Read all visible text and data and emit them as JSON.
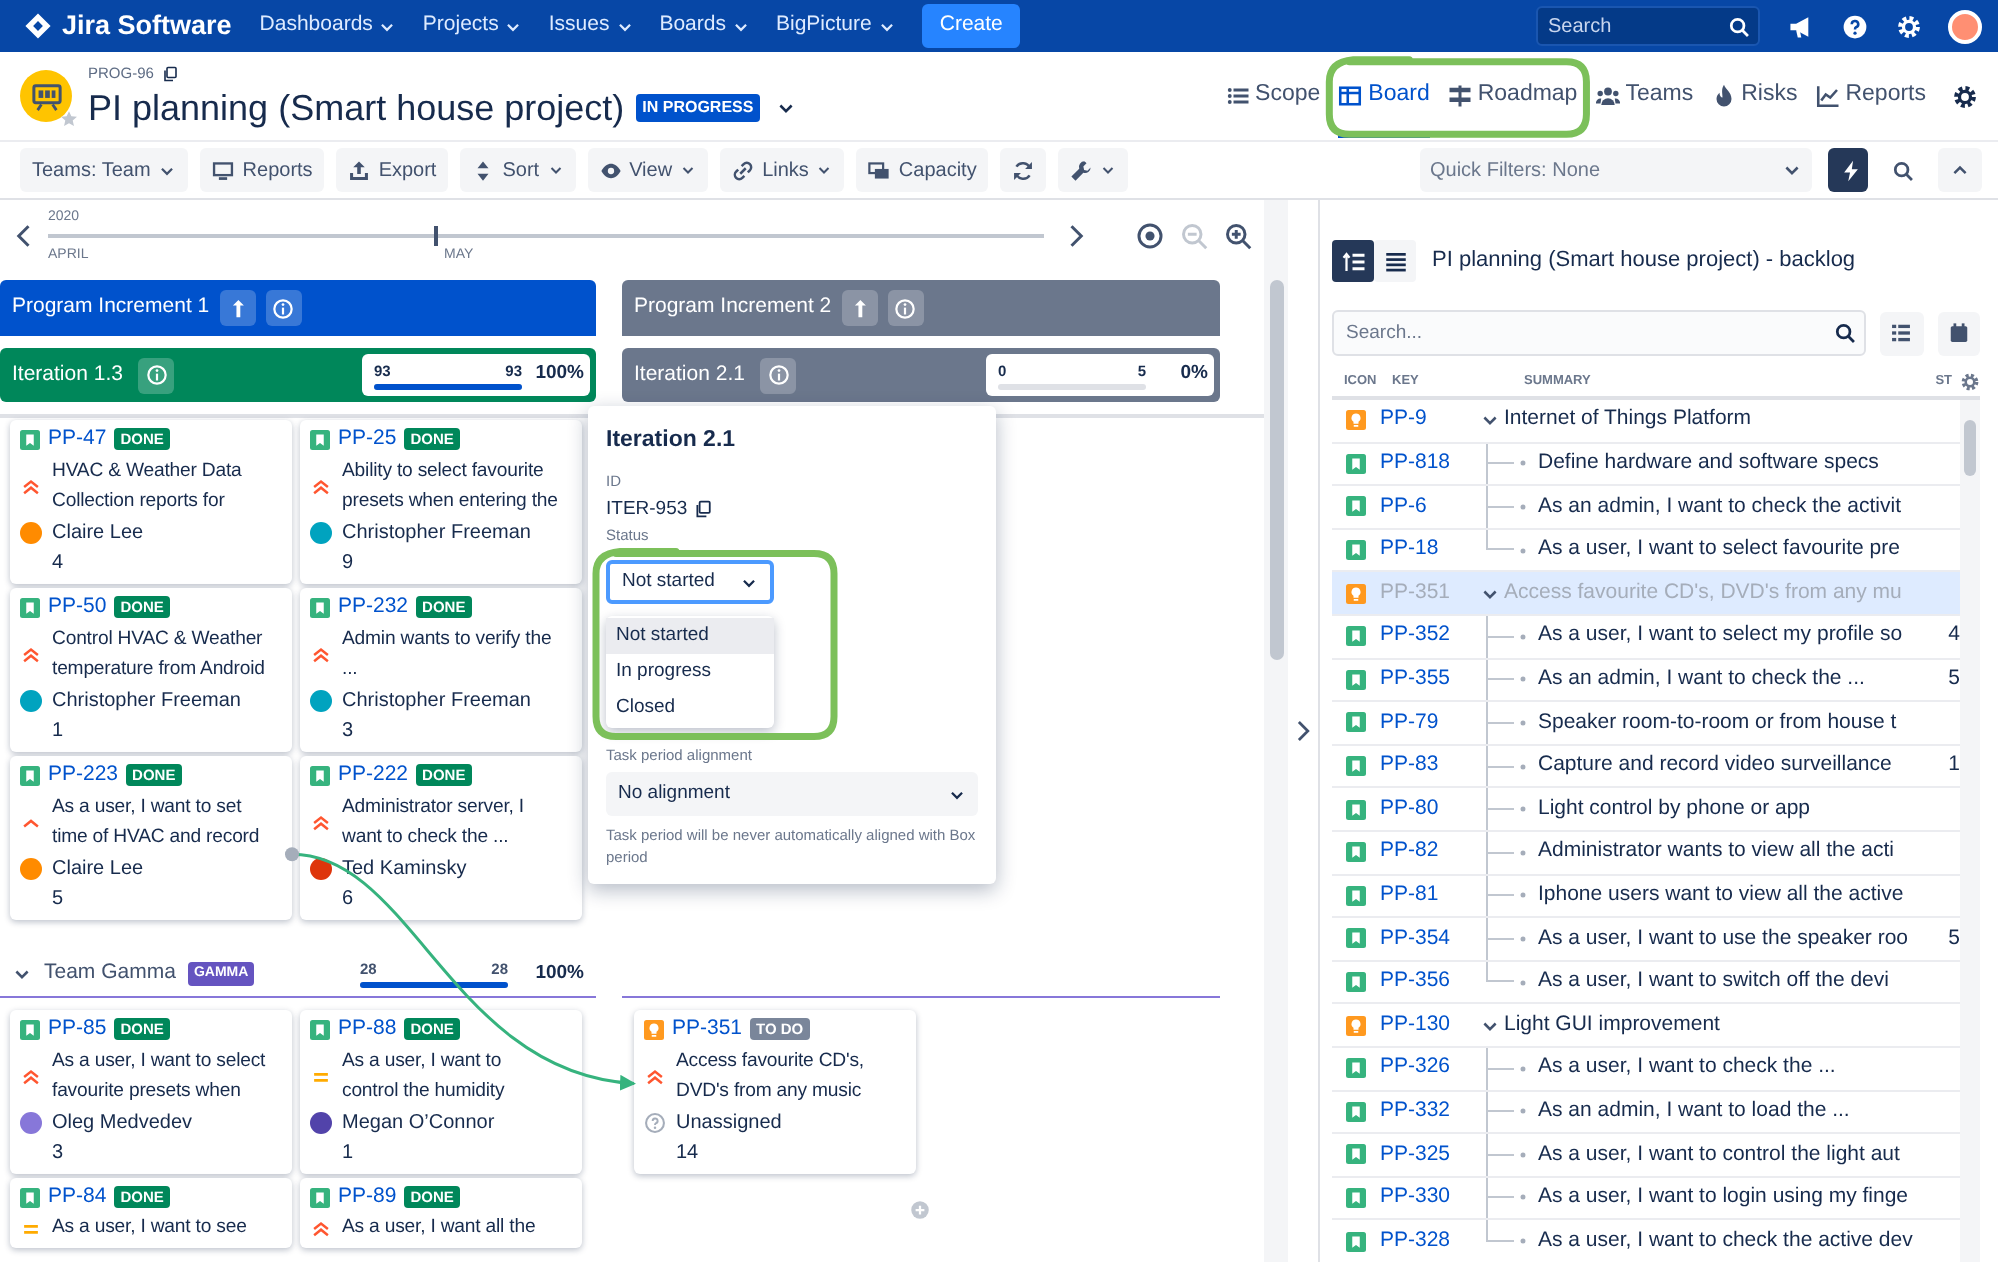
{
  "navbar": {
    "product": "Jira Software",
    "menus": [
      "Dashboards",
      "Projects",
      "Issues",
      "Boards",
      "BigPicture"
    ],
    "create": "Create",
    "search": {
      "placeholder": "Search"
    }
  },
  "header": {
    "key": "PROG-96",
    "title": "PI planning (Smart house project)",
    "status": "IN PROGRESS",
    "tabs": [
      {
        "label": "Scope",
        "kind": "list",
        "selected": false
      },
      {
        "label": "Board",
        "kind": "board",
        "selected": true
      },
      {
        "label": "Roadmap",
        "kind": "roadmap",
        "selected": false
      },
      {
        "label": "Teams",
        "kind": "teams",
        "selected": false
      },
      {
        "label": "Risks",
        "kind": "risks",
        "selected": false
      },
      {
        "label": "Reports",
        "kind": "reports",
        "selected": false
      }
    ]
  },
  "toolbar": {
    "teams": "Teams: Team",
    "buttons": [
      {
        "label": "Reports",
        "kind": "monitor",
        "menu": false
      },
      {
        "label": "Export",
        "kind": "export",
        "menu": false
      },
      {
        "label": "Sort",
        "kind": "sort",
        "menu": true
      },
      {
        "label": "View",
        "kind": "eye",
        "menu": true
      },
      {
        "label": "Links",
        "kind": "link",
        "menu": true
      },
      {
        "label": "Capacity",
        "kind": "capacity",
        "menu": false
      },
      {
        "kind": "refresh",
        "menu": false
      },
      {
        "kind": "wrench",
        "menu": true
      }
    ],
    "quick_filters": {
      "placeholder": "Quick Filters: None"
    }
  },
  "timeline": {
    "year": "2020",
    "months": [
      "APRIL",
      "MAY"
    ],
    "zoom_out": {
      "disabled": true
    }
  },
  "increments": [
    {
      "name": "Program Increment 1",
      "color": "#0052cc",
      "iteration": {
        "name": "Iteration 1.3",
        "color": "#00875a",
        "done": "93",
        "total": "93",
        "percent": "100%",
        "level": 1
      }
    },
    {
      "name": "Program Increment 2",
      "color": "#6b778c",
      "iteration": {
        "name": "Iteration 2.1",
        "color": "#6b778c",
        "done": "0",
        "total": "5",
        "percent": "0%",
        "level": 0
      }
    }
  ],
  "lanes": [
    {
      "columns": [
        [
          {
            "key": "PP-47",
            "kind": "story",
            "status": {
              "label": "DONE",
              "kind": "done"
            },
            "priority": {
              "kind": "highest"
            },
            "summary": "HVAC & Weather Data\nCollection reports for",
            "assignee": "Claire Lee",
            "color": "#ff8b00",
            "points": "4"
          },
          {
            "key": "PP-25",
            "kind": "story",
            "status": {
              "label": "DONE",
              "kind": "done"
            },
            "priority": {
              "kind": "highest"
            },
            "summary": "Ability to select favourite\npresets when entering the",
            "assignee": "Christopher Freeman",
            "color": "#00a3bf",
            "points": "9"
          },
          {
            "key": "PP-50",
            "kind": "story",
            "status": {
              "label": "DONE",
              "kind": "done"
            },
            "priority": {
              "kind": "highest"
            },
            "summary": "Control HVAC & Weather\ntemperature from Android",
            "assignee": "Christopher Freeman",
            "color": "#00a3bf",
            "points": "1"
          },
          {
            "key": "PP-232",
            "kind": "story",
            "status": {
              "label": "DONE",
              "kind": "done"
            },
            "priority": {
              "kind": "highest"
            },
            "summary": "Admin wants to verify the\n...",
            "assignee": "Christopher Freeman",
            "color": "#00a3bf",
            "points": "3"
          },
          {
            "key": "PP-223",
            "kind": "story",
            "status": {
              "label": "DONE",
              "kind": "done"
            },
            "priority": {
              "kind": "high"
            },
            "summary": "As a user, I want to set\ntime of HVAC and record",
            "assignee": "Claire Lee",
            "color": "#ff8b00",
            "points": "5",
            "link_out": true
          },
          {
            "key": "PP-222",
            "kind": "story",
            "status": {
              "label": "DONE",
              "kind": "done"
            },
            "priority": {
              "kind": "highest"
            },
            "summary": "Administrator server, I\nwant to check the ...",
            "assignee": "Ted Kaminsky",
            "color": "#de350b",
            "points": "6"
          }
        ],
        []
      ]
    },
    {
      "team": "Team Gamma",
      "badge": "GAMMA",
      "done": "28",
      "total": "28",
      "percent": "100%",
      "level": 1,
      "columns": [
        [
          {
            "key": "PP-85",
            "kind": "story",
            "status": {
              "label": "DONE",
              "kind": "done"
            },
            "priority": {
              "kind": "highest"
            },
            "summary": "As a user, I want to select\nfavourite presets when",
            "assignee": "Oleg Medvedev",
            "color": "#8777d9",
            "points": "3"
          },
          {
            "key": "PP-88",
            "kind": "story",
            "status": {
              "label": "DONE",
              "kind": "done"
            },
            "priority": {
              "kind": "medium"
            },
            "summary": "As a user, I want to\ncontrol the humidity",
            "assignee": "Megan O’Connor",
            "color": "#5243aa",
            "points": "1"
          },
          {
            "key": "PP-84",
            "kind": "story",
            "status": {
              "label": "DONE",
              "kind": "done"
            },
            "priority": {
              "kind": "medium"
            },
            "summary": "As a user, I want to see"
          },
          {
            "key": "PP-89",
            "kind": "story",
            "status": {
              "label": "DONE",
              "kind": "done"
            },
            "priority": {
              "kind": "highest"
            },
            "summary": "As a user, I want all the"
          }
        ],
        [
          {
            "key": "PP-351",
            "kind": "epic",
            "status": {
              "label": "TO DO",
              "kind": "todo"
            },
            "priority": {
              "kind": "highest"
            },
            "summary": "Access favourite CD's,\nDVD's from any music",
            "assignee": "Unassigned",
            "points": "14",
            "link_in": true
          }
        ]
      ]
    }
  ],
  "popup": {
    "title": "Iteration 2.1",
    "id_label": "ID",
    "id": "ITER-953",
    "status_label": "Status",
    "status": "Not started",
    "options": [
      {
        "label": "Not started",
        "selected": true
      },
      {
        "label": "In progress",
        "selected": false
      },
      {
        "label": "Closed",
        "selected": false
      }
    ],
    "alignment_label": "Task period alignment",
    "alignment": "No alignment",
    "hint": "Task period will be never automatically aligned with Box period"
  },
  "backlog": {
    "title": "PI planning (Smart house project) - backlog",
    "views": [
      {
        "kind": "tree",
        "selected": true
      },
      {
        "kind": "lines",
        "selected": false
      }
    ],
    "search": {
      "placeholder": "Search..."
    },
    "columns": [
      "ICON",
      "KEY",
      "SUMMARY",
      "ST"
    ],
    "rows": [
      {
        "kind": "epic",
        "key": "PP-9",
        "summary": "Internet of Things Platform",
        "expanded": true,
        "selected": false,
        "children": [
          {
            "kind": "story",
            "key": "PP-818",
            "summary": "Define hardware and software specs",
            "selected": false
          },
          {
            "kind": "story",
            "key": "PP-6",
            "summary": "As an admin, I want to check the activit",
            "selected": false
          },
          {
            "kind": "story",
            "key": "PP-18",
            "summary": "As a user, I want to select favourite pre",
            "selected": false
          }
        ]
      },
      {
        "kind": "epic",
        "key": "PP-351",
        "summary": "Access favourite CD's, DVD's from any mu",
        "expanded": true,
        "selected": true,
        "children": [
          {
            "kind": "story",
            "key": "PP-352",
            "summary": "As a user, I want to select my profile so",
            "sp": "4",
            "selected": false
          },
          {
            "kind": "story",
            "key": "PP-355",
            "summary": "As an admin, I want to check the ...",
            "sp": "5",
            "selected": false
          },
          {
            "kind": "story",
            "key": "PP-79",
            "summary": "Speaker room-to-room or from house t",
            "selected": false
          },
          {
            "kind": "story",
            "key": "PP-83",
            "summary": "Capture and record video surveillance",
            "sp": "1",
            "selected": false
          },
          {
            "kind": "story",
            "key": "PP-80",
            "summary": "Light control by phone or app",
            "selected": false
          },
          {
            "kind": "story",
            "key": "PP-82",
            "summary": "Administrator wants to view all the acti",
            "selected": false
          },
          {
            "kind": "story",
            "key": "PP-81",
            "summary": "Iphone users want to view all the active",
            "selected": false
          },
          {
            "kind": "story",
            "key": "PP-354",
            "summary": "As a user, I want to use the speaker roo",
            "sp": "5",
            "selected": false
          },
          {
            "kind": "story",
            "key": "PP-356",
            "summary": "As a user, I want to switch off the devi",
            "selected": false
          }
        ]
      },
      {
        "kind": "epic",
        "key": "PP-130",
        "summary": "Light GUI improvement",
        "expanded": true,
        "selected": false,
        "children": [
          {
            "kind": "story",
            "key": "PP-326",
            "summary": "As a user, I want to check the ...",
            "selected": false
          },
          {
            "kind": "story",
            "key": "PP-332",
            "summary": "As an admin, I want to load the ...",
            "selected": false
          },
          {
            "kind": "story",
            "key": "PP-325",
            "summary": "As a user, I want to control the light aut",
            "selected": false
          },
          {
            "kind": "story",
            "key": "PP-330",
            "summary": "As a user, I want to login using my finge",
            "selected": false
          },
          {
            "kind": "story",
            "key": "PP-328",
            "summary": "As a user, I want to check the active dev",
            "selected": false
          }
        ]
      }
    ]
  }
}
